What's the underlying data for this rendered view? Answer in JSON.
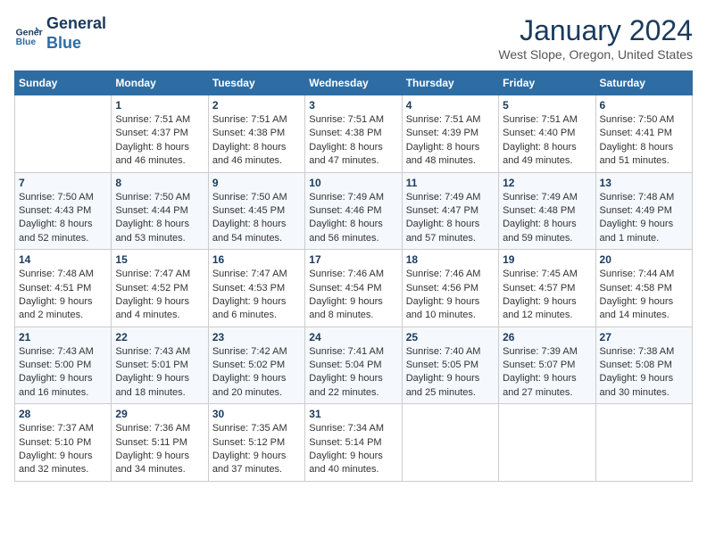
{
  "header": {
    "logo_line1": "General",
    "logo_line2": "Blue",
    "month_title": "January 2024",
    "location": "West Slope, Oregon, United States"
  },
  "weekdays": [
    "Sunday",
    "Monday",
    "Tuesday",
    "Wednesday",
    "Thursday",
    "Friday",
    "Saturday"
  ],
  "weeks": [
    [
      {
        "day": "",
        "info": ""
      },
      {
        "day": "1",
        "info": "Sunrise: 7:51 AM\nSunset: 4:37 PM\nDaylight: 8 hours\nand 46 minutes."
      },
      {
        "day": "2",
        "info": "Sunrise: 7:51 AM\nSunset: 4:38 PM\nDaylight: 8 hours\nand 46 minutes."
      },
      {
        "day": "3",
        "info": "Sunrise: 7:51 AM\nSunset: 4:38 PM\nDaylight: 8 hours\nand 47 minutes."
      },
      {
        "day": "4",
        "info": "Sunrise: 7:51 AM\nSunset: 4:39 PM\nDaylight: 8 hours\nand 48 minutes."
      },
      {
        "day": "5",
        "info": "Sunrise: 7:51 AM\nSunset: 4:40 PM\nDaylight: 8 hours\nand 49 minutes."
      },
      {
        "day": "6",
        "info": "Sunrise: 7:50 AM\nSunset: 4:41 PM\nDaylight: 8 hours\nand 51 minutes."
      }
    ],
    [
      {
        "day": "7",
        "info": "Sunrise: 7:50 AM\nSunset: 4:43 PM\nDaylight: 8 hours\nand 52 minutes."
      },
      {
        "day": "8",
        "info": "Sunrise: 7:50 AM\nSunset: 4:44 PM\nDaylight: 8 hours\nand 53 minutes."
      },
      {
        "day": "9",
        "info": "Sunrise: 7:50 AM\nSunset: 4:45 PM\nDaylight: 8 hours\nand 54 minutes."
      },
      {
        "day": "10",
        "info": "Sunrise: 7:49 AM\nSunset: 4:46 PM\nDaylight: 8 hours\nand 56 minutes."
      },
      {
        "day": "11",
        "info": "Sunrise: 7:49 AM\nSunset: 4:47 PM\nDaylight: 8 hours\nand 57 minutes."
      },
      {
        "day": "12",
        "info": "Sunrise: 7:49 AM\nSunset: 4:48 PM\nDaylight: 8 hours\nand 59 minutes."
      },
      {
        "day": "13",
        "info": "Sunrise: 7:48 AM\nSunset: 4:49 PM\nDaylight: 9 hours\nand 1 minute."
      }
    ],
    [
      {
        "day": "14",
        "info": "Sunrise: 7:48 AM\nSunset: 4:51 PM\nDaylight: 9 hours\nand 2 minutes."
      },
      {
        "day": "15",
        "info": "Sunrise: 7:47 AM\nSunset: 4:52 PM\nDaylight: 9 hours\nand 4 minutes."
      },
      {
        "day": "16",
        "info": "Sunrise: 7:47 AM\nSunset: 4:53 PM\nDaylight: 9 hours\nand 6 minutes."
      },
      {
        "day": "17",
        "info": "Sunrise: 7:46 AM\nSunset: 4:54 PM\nDaylight: 9 hours\nand 8 minutes."
      },
      {
        "day": "18",
        "info": "Sunrise: 7:46 AM\nSunset: 4:56 PM\nDaylight: 9 hours\nand 10 minutes."
      },
      {
        "day": "19",
        "info": "Sunrise: 7:45 AM\nSunset: 4:57 PM\nDaylight: 9 hours\nand 12 minutes."
      },
      {
        "day": "20",
        "info": "Sunrise: 7:44 AM\nSunset: 4:58 PM\nDaylight: 9 hours\nand 14 minutes."
      }
    ],
    [
      {
        "day": "21",
        "info": "Sunrise: 7:43 AM\nSunset: 5:00 PM\nDaylight: 9 hours\nand 16 minutes."
      },
      {
        "day": "22",
        "info": "Sunrise: 7:43 AM\nSunset: 5:01 PM\nDaylight: 9 hours\nand 18 minutes."
      },
      {
        "day": "23",
        "info": "Sunrise: 7:42 AM\nSunset: 5:02 PM\nDaylight: 9 hours\nand 20 minutes."
      },
      {
        "day": "24",
        "info": "Sunrise: 7:41 AM\nSunset: 5:04 PM\nDaylight: 9 hours\nand 22 minutes."
      },
      {
        "day": "25",
        "info": "Sunrise: 7:40 AM\nSunset: 5:05 PM\nDaylight: 9 hours\nand 25 minutes."
      },
      {
        "day": "26",
        "info": "Sunrise: 7:39 AM\nSunset: 5:07 PM\nDaylight: 9 hours\nand 27 minutes."
      },
      {
        "day": "27",
        "info": "Sunrise: 7:38 AM\nSunset: 5:08 PM\nDaylight: 9 hours\nand 30 minutes."
      }
    ],
    [
      {
        "day": "28",
        "info": "Sunrise: 7:37 AM\nSunset: 5:10 PM\nDaylight: 9 hours\nand 32 minutes."
      },
      {
        "day": "29",
        "info": "Sunrise: 7:36 AM\nSunset: 5:11 PM\nDaylight: 9 hours\nand 34 minutes."
      },
      {
        "day": "30",
        "info": "Sunrise: 7:35 AM\nSunset: 5:12 PM\nDaylight: 9 hours\nand 37 minutes."
      },
      {
        "day": "31",
        "info": "Sunrise: 7:34 AM\nSunset: 5:14 PM\nDaylight: 9 hours\nand 40 minutes."
      },
      {
        "day": "",
        "info": ""
      },
      {
        "day": "",
        "info": ""
      },
      {
        "day": "",
        "info": ""
      }
    ]
  ]
}
